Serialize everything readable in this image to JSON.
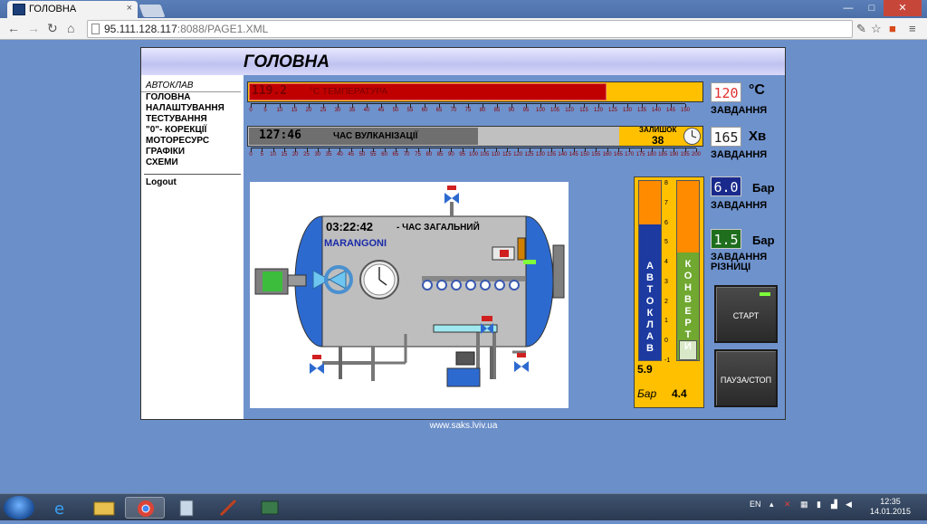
{
  "browser": {
    "tab_title": "ГОЛОВНА",
    "tab_close": "×",
    "url_host": "95.111.128.117",
    "url_rest": ":8088/PAGE1.XML",
    "win_min": "—",
    "win_max": "□",
    "win_close": "✕"
  },
  "header": {
    "title": "ГОЛОВНА"
  },
  "sidebar": {
    "section": "АВТОКЛАВ",
    "items": [
      "ГОЛОВНА",
      "НАЛАШТУВАННЯ",
      "ТЕСТУВАННЯ",
      "\"0\"- КОРЕКЦІЇ",
      "МОТОРЕСУРС",
      "ГРАФІКИ",
      "СХЕМИ"
    ],
    "logout": "Logout"
  },
  "temperature": {
    "value": "119.2",
    "label": "°C ТЕМПЕРАТУРА",
    "fill_fraction": 0.79,
    "scale": [
      "0",
      "5",
      "10",
      "15",
      "20",
      "25",
      "30",
      "35",
      "40",
      "45",
      "50",
      "55",
      "60",
      "65",
      "70",
      "75",
      "80",
      "85",
      "90",
      "95",
      "100",
      "105",
      "110",
      "115",
      "120",
      "125",
      "130",
      "135",
      "140",
      "145",
      "150"
    ],
    "setpoint": "120",
    "unit": "°C",
    "setpoint_caption": "ЗАВДАННЯ"
  },
  "time": {
    "value": "127:46",
    "label": "ЧАС ВУЛКАНІЗАЦІЇ",
    "fill_fraction": 0.62,
    "remaining_label": "ЗАЛИШОК",
    "remaining_value": "38",
    "scale": [
      "0",
      "5",
      "10",
      "15",
      "20",
      "25",
      "30",
      "35",
      "40",
      "45",
      "50",
      "55",
      "60",
      "65",
      "70",
      "75",
      "80",
      "85",
      "90",
      "95",
      "100",
      "105",
      "110",
      "115",
      "120",
      "125",
      "130",
      "135",
      "140",
      "145",
      "150",
      "155",
      "160",
      "165",
      "170",
      "175",
      "180",
      "185",
      "190",
      "195",
      "200"
    ],
    "setpoint": "165",
    "unit": "Хв",
    "setpoint_caption": "ЗАВДАННЯ"
  },
  "pressure": {
    "setpoint": "6.0",
    "unit": "Бар",
    "setpoint_caption": "ЗАВДАННЯ",
    "diff_setpoint": "1.5",
    "diff_unit": "Бар",
    "diff_caption_1": "ЗАВДАННЯ",
    "diff_caption_2": "РІЗНИЦІ"
  },
  "schematic": {
    "total_time": "03:22:42",
    "total_time_label": "- ЧАС ЗАГАЛЬНИЙ",
    "brand": "MARANGONI"
  },
  "gauges": {
    "autoclave_label": "АВТОКЛАВ",
    "autoclave_value": "5.9",
    "envelope_label": "КОНВЕРТИ",
    "envelope_value": "4.4",
    "unit": "Бар",
    "scale": [
      "8",
      "7",
      "6",
      "5",
      "4",
      "3",
      "2",
      "1",
      "0",
      "-1"
    ],
    "autoclave_fraction": 0.76,
    "envelope_fraction": 0.6
  },
  "buttons": {
    "start": "СТАРТ",
    "pause_stop": "ПАУЗА/СТОП"
  },
  "footer": {
    "url": "www.saks.lviv.ua"
  },
  "taskbar": {
    "lang": "EN",
    "time": "12:35",
    "date": "14.01.2015"
  },
  "colors": {
    "temp_fill": "#c00000",
    "temp_bg": "#ffc000",
    "time_fill": "#7f7f7f",
    "time_bg": "#c0c0c0",
    "accent_orange": "#ff8c00",
    "gauge_green": "#70a830",
    "readout_blue": "#1a2a8c",
    "readout_green": "#1e6e1e"
  }
}
